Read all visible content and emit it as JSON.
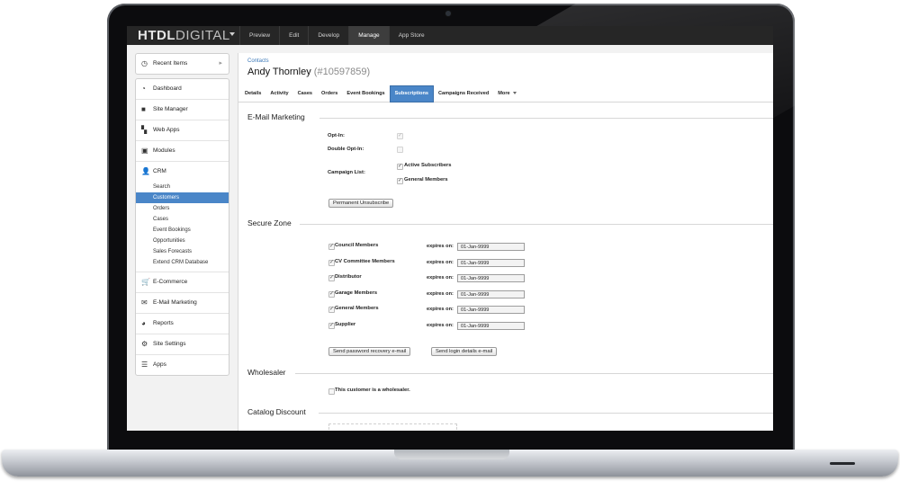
{
  "topbar": {
    "brand_strong": "HTDL",
    "brand_rest": "DIGITAL",
    "nav": [
      "Preview",
      "Edit",
      "Develop",
      "Manage",
      "App Store"
    ],
    "active_nav": "Manage"
  },
  "sidebar": {
    "recent": "Recent Items",
    "items_top": [
      {
        "label": "Dashboard",
        "icon": "dashboard-icon"
      },
      {
        "label": "Site Manager",
        "icon": "folder-icon"
      },
      {
        "label": "Web Apps",
        "icon": "web-apps-icon"
      },
      {
        "label": "Modules",
        "icon": "modules-icon"
      }
    ],
    "crm": {
      "label": "CRM",
      "icon": "user-icon",
      "sub": [
        "Search",
        "Customers",
        "Orders",
        "Cases",
        "Event Bookings",
        "Opportunities",
        "Sales Forecasts",
        "Extend CRM Database"
      ],
      "active_sub": "Customers"
    },
    "items_bottom": [
      {
        "label": "E-Commerce",
        "icon": "cart-icon"
      },
      {
        "label": "E-Mail Marketing",
        "icon": "email-icon"
      },
      {
        "label": "Reports",
        "icon": "pie-chart-icon"
      },
      {
        "label": "Site Settings",
        "icon": "gear-icon"
      },
      {
        "label": "Apps",
        "icon": "stack-icon"
      }
    ]
  },
  "header": {
    "breadcrumb": "Contacts",
    "name": "Andy Thornley",
    "id": "(#10597859)"
  },
  "tabs": [
    "Details",
    "Activity",
    "Cases",
    "Orders",
    "Event Bookings",
    "Subscriptions",
    "Campaigns Received",
    "More"
  ],
  "active_tab": "Subscriptions",
  "email_marketing": {
    "title": "E-Mail Marketing",
    "opt_in_label": "Opt-In:",
    "opt_in": true,
    "double_opt_in_label": "Double Opt-In:",
    "double_opt_in": false,
    "campaign_list_label": "Campaign List:",
    "campaigns": [
      {
        "label": "Active Subscribers",
        "checked": true
      },
      {
        "label": "General Members",
        "checked": true
      }
    ],
    "unsubscribe_button": "Permanent Unsubscribe"
  },
  "secure_zone": {
    "title": "Secure Zone",
    "expires_label": "expires on:",
    "zones": [
      {
        "label": "Council Members",
        "checked": true,
        "expires": "01-Jan-9999"
      },
      {
        "label": "CV Committee Members",
        "checked": true,
        "expires": "01-Jan-9999"
      },
      {
        "label": "Distributor",
        "checked": true,
        "expires": "01-Jan-9999"
      },
      {
        "label": "Garage Members",
        "checked": true,
        "expires": "01-Jan-9999"
      },
      {
        "label": "General Members",
        "checked": true,
        "expires": "01-Jan-9999"
      },
      {
        "label": "Supplier",
        "checked": true,
        "expires": "01-Jan-9999"
      }
    ],
    "recovery_button": "Send password recovery e-mail",
    "login_button": "Send login details e-mail"
  },
  "wholesaler": {
    "title": "Wholesaler",
    "checkbox_label": "This customer is a wholesaler.",
    "checked": false
  },
  "catalog_discount": {
    "title": "Catalog Discount"
  }
}
